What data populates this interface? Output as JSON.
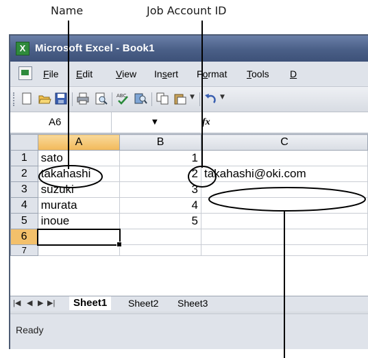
{
  "callouts": {
    "name": "Name",
    "job_account_id": "Job Account ID"
  },
  "window": {
    "title": "Microsoft Excel - Book1",
    "app_icon_glyph": "X"
  },
  "menu": {
    "items": [
      {
        "label": "File",
        "ul": "F",
        "rest": "ile"
      },
      {
        "label": "Edit",
        "ul": "E",
        "rest": "dit"
      },
      {
        "label": "View",
        "ul": "V",
        "rest": "iew"
      },
      {
        "label": "Insert",
        "pre": "In",
        "ul": "s",
        "rest": "ert"
      },
      {
        "label": "Format",
        "pre": "F",
        "ul": "o",
        "rest": "rmat"
      },
      {
        "label": "Tools",
        "ul": "T",
        "rest": "ools"
      },
      {
        "label": "D",
        "ul": "D",
        "rest": ""
      }
    ]
  },
  "toolbar": {
    "icons": [
      "new-icon",
      "open-icon",
      "save-icon",
      "print-icon",
      "print-preview-icon",
      "spelling-icon",
      "research-icon",
      "copy-icon",
      "paste-icon",
      "undo-icon"
    ]
  },
  "formula_bar": {
    "name_box": "A6",
    "fx_label": "fx",
    "formula": ""
  },
  "grid": {
    "columns": [
      "A",
      "B",
      "C"
    ],
    "rows": [
      {
        "num": "1",
        "A": "sato",
        "B": "1",
        "C": ""
      },
      {
        "num": "2",
        "A": "takahashi",
        "B": "2",
        "C": "takahashi@oki.com"
      },
      {
        "num": "3",
        "A": "suzuki",
        "B": "3",
        "C": ""
      },
      {
        "num": "4",
        "A": "murata",
        "B": "4",
        "C": ""
      },
      {
        "num": "5",
        "A": "inoue",
        "B": "5",
        "C": ""
      },
      {
        "num": "6",
        "A": "",
        "B": "",
        "C": ""
      },
      {
        "num": "7",
        "A": "",
        "B": "",
        "C": ""
      }
    ],
    "selected_cell": "A6"
  },
  "sheet_tabs": {
    "nav": [
      "|◀",
      "◀",
      "▶",
      "▶|"
    ],
    "tabs": [
      "Sheet1",
      "Sheet2",
      "Sheet3"
    ],
    "active": "Sheet1"
  },
  "status": {
    "text": "Ready"
  },
  "colors": {
    "title_bar": "#4a5f87",
    "active_header": "#f2b95a",
    "callout_line": "#000000"
  }
}
